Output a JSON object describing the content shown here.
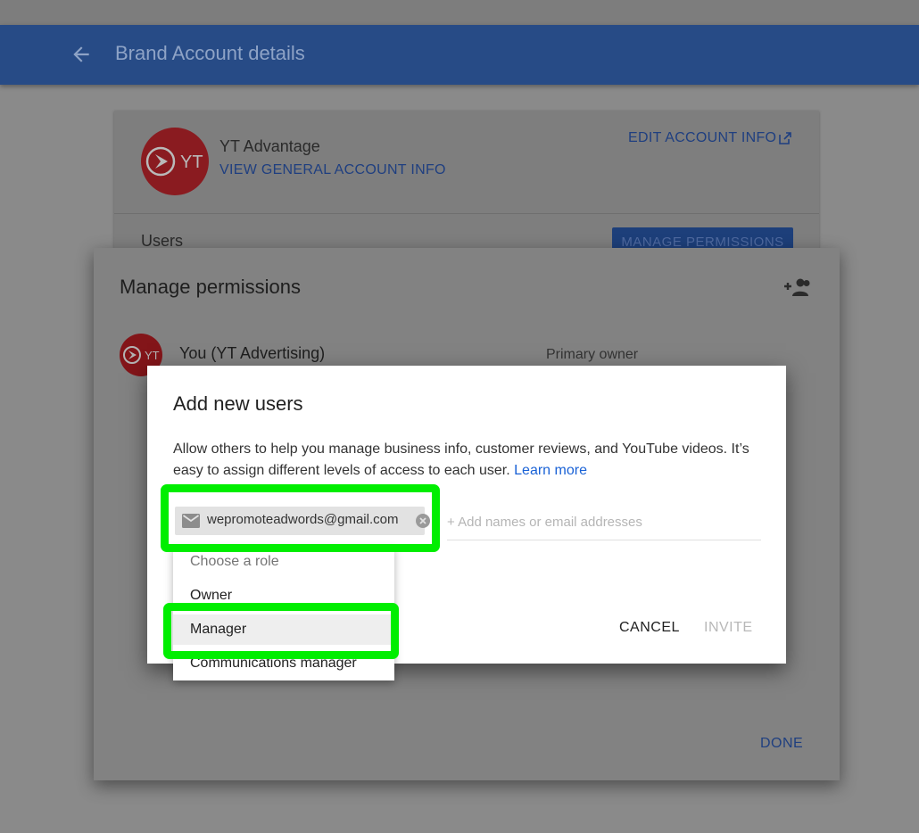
{
  "appbar": {
    "title": "Brand Account details"
  },
  "account_card": {
    "logo_text": "YT",
    "name": "YT Advantage",
    "view_info_label": "VIEW GENERAL ACCOUNT INFO",
    "edit_info_label": "EDIT ACCOUNT INFO",
    "users_label": "Users",
    "manage_button_label": "MANAGE PERMISSIONS"
  },
  "permissions_dialog": {
    "title": "Manage permissions",
    "owner": {
      "avatar_text": "YT",
      "name": "You (YT Advertising)",
      "role": "Primary owner"
    },
    "done_label": "DONE"
  },
  "add_users_dialog": {
    "title": "Add new users",
    "description": "Allow others to help you manage business info, customer reviews, and YouTube videos. It’s easy to assign different levels of access to each user.",
    "learn_more": "Learn more",
    "chip_email": "wepromoteadwords@gmail.com",
    "input_placeholder": "+ Add names or email addresses",
    "cancel_label": "CANCEL",
    "invite_label": "INVITE"
  },
  "role_menu": {
    "placeholder": "Choose a role",
    "options": [
      "Owner",
      "Manager",
      "Communications manager"
    ],
    "highlighted": "Manager"
  },
  "colors": {
    "appbar": "#274b86",
    "link_blue": "#1a62d6",
    "highlight_green": "#00ee00",
    "logo_red": "#c41f26"
  },
  "icons": [
    "back-arrow-icon",
    "open-in-new-icon",
    "add-user-icon",
    "email-icon",
    "chip-remove-icon"
  ]
}
